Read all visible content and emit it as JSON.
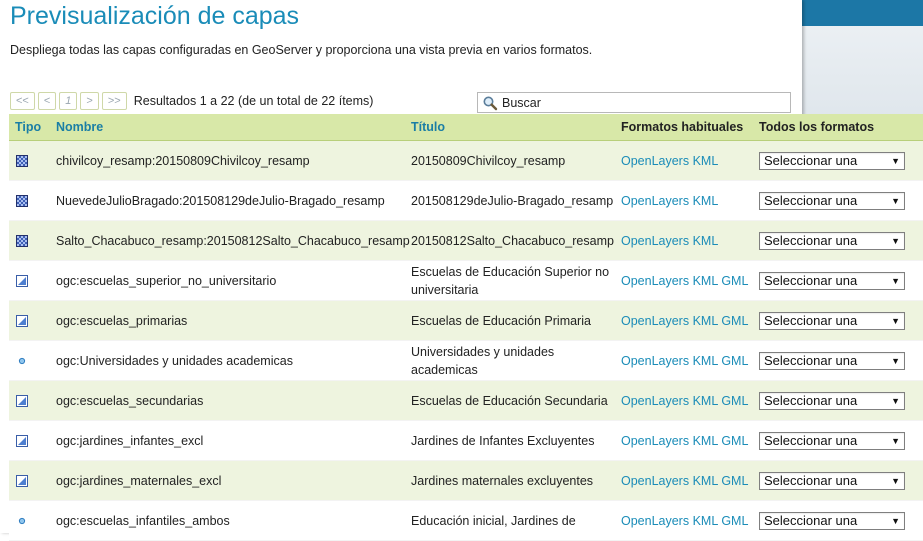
{
  "page": {
    "title": "Previsualización de capas",
    "description": "Despliega todas las capas configuradas en GeoServer y proporciona una vista previa en varios formatos."
  },
  "pager": {
    "first": "<<",
    "prev": "<",
    "current": "1",
    "next": ">",
    "last": ">>",
    "results": "Resultados 1 a 22 (de un total de 22 ítems)"
  },
  "search": {
    "value": "Buscar",
    "icon": "magnifier-icon"
  },
  "table": {
    "headers": {
      "tipo": "Tipo",
      "nombre": "Nombre",
      "titulo": "Título",
      "formatos": "Formatos habituales",
      "todos": "Todos los formatos"
    },
    "select_label": "Seleccionar una",
    "rows": [
      {
        "icon": "raster-icon",
        "nombre": "chivilcoy_resamp:20150809Chivilcoy_resamp",
        "titulo": "20150809Chivilcoy_resamp",
        "formats": [
          "OpenLayers",
          "KML"
        ]
      },
      {
        "icon": "raster-icon",
        "nombre": "NuevedeJulioBragado:201508129deJulio-Bragado_resamp",
        "titulo": "201508129deJulio-Bragado_resamp",
        "formats": [
          "OpenLayers",
          "KML"
        ]
      },
      {
        "icon": "raster-icon",
        "nombre": "Salto_Chacabuco_resamp:20150812Salto_Chacabuco_resamp",
        "titulo": "20150812Salto_Chacabuco_resamp",
        "formats": [
          "OpenLayers",
          "KML"
        ]
      },
      {
        "icon": "polygon-icon",
        "nombre": "ogc:escuelas_superior_no_universitario",
        "titulo": "Escuelas de Educación Superior no universitaria",
        "formats": [
          "OpenLayers",
          "KML",
          "GML"
        ]
      },
      {
        "icon": "polygon-icon",
        "nombre": "ogc:escuelas_primarias",
        "titulo": "Escuelas de Educación Primaria",
        "formats": [
          "OpenLayers",
          "KML",
          "GML"
        ]
      },
      {
        "icon": "point-icon",
        "nombre": "ogc:Universidades y unidades academicas",
        "titulo": "Universidades y unidades academicas",
        "formats": [
          "OpenLayers",
          "KML",
          "GML"
        ]
      },
      {
        "icon": "polygon-icon",
        "nombre": "ogc:escuelas_secundarias",
        "titulo": "Escuelas de Educación Secundaria",
        "formats": [
          "OpenLayers",
          "KML",
          "GML"
        ]
      },
      {
        "icon": "polygon-icon",
        "nombre": "ogc:jardines_infantes_excl",
        "titulo": "Jardines de Infantes Excluyentes",
        "formats": [
          "OpenLayers",
          "KML",
          "GML"
        ]
      },
      {
        "icon": "polygon-icon",
        "nombre": "ogc:jardines_maternales_excl",
        "titulo": "Jardines maternales excluyentes",
        "formats": [
          "OpenLayers",
          "KML",
          "GML"
        ]
      },
      {
        "icon": "point-icon",
        "nombre": "ogc:escuelas_infantiles_ambos",
        "titulo": "Educación inicial, Jardines de",
        "formats": [
          "OpenLayers",
          "KML",
          "GML"
        ]
      }
    ]
  },
  "colors": {
    "title": "#1a8cb8",
    "header_bg": "#d8e8a8",
    "row_alt_bg": "#eef4df",
    "link": "#1a8cb8",
    "chrome_bar": "#1c77a6"
  }
}
